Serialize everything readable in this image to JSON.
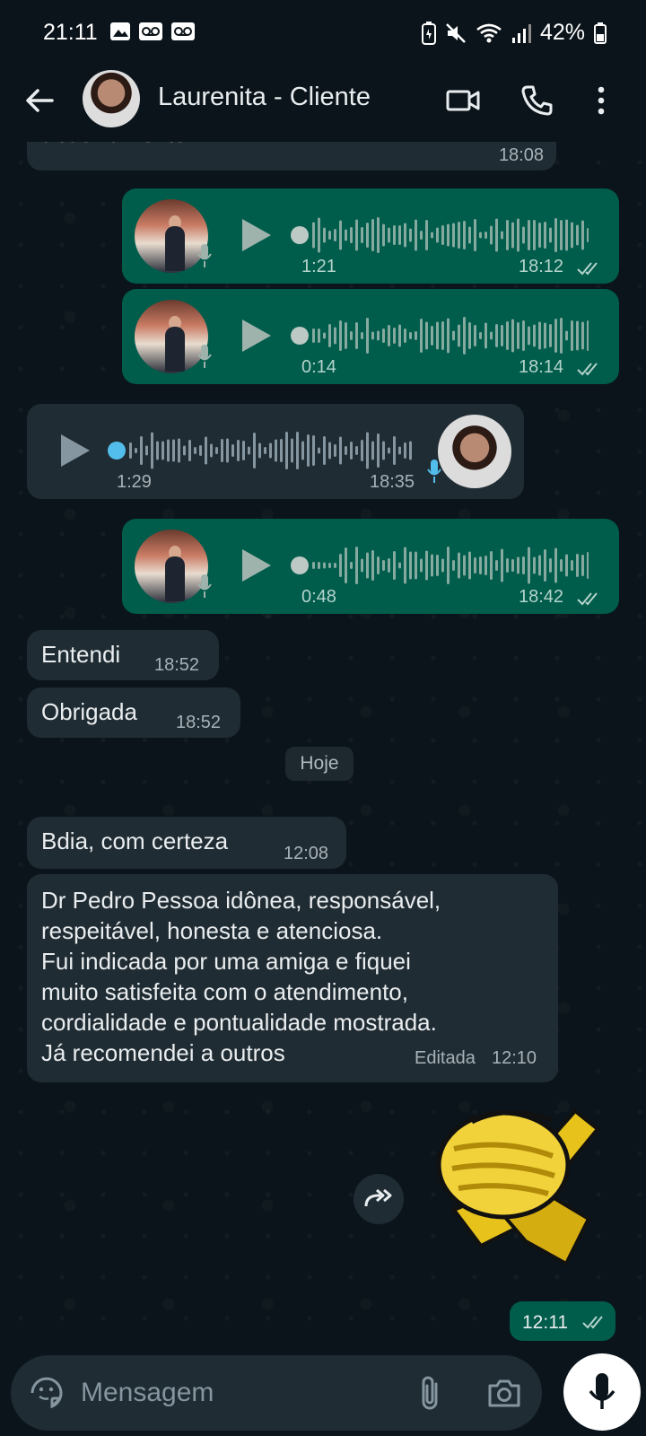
{
  "status_bar": {
    "time": "21:11",
    "battery": "42%"
  },
  "header": {
    "contact_name": "Laurenita - Cliente"
  },
  "messages": {
    "m1": {
      "text": "abusivamente?",
      "time": "18:08"
    },
    "v1": {
      "duration": "1:21",
      "time": "18:12"
    },
    "v2": {
      "duration": "0:14",
      "time": "18:14"
    },
    "v3": {
      "duration": "1:29",
      "time": "18:35"
    },
    "v4": {
      "duration": "0:48",
      "time": "18:42"
    },
    "m2": {
      "text": "Entendi",
      "time": "18:52"
    },
    "m3": {
      "text": "Obrigada",
      "time": "18:52"
    },
    "date_separator": "Hoje",
    "m4": {
      "text": "Bdia, com certeza",
      "time": "12:08"
    },
    "m5": {
      "lines": [
        "Dr Pedro Pessoa idônea, responsável,",
        "respeitável, honesta e atenciosa.",
        "Fui indicada por uma amiga e fiquei",
        "muito satisfeita com o atendimento,",
        "cordialidade e pontualidade mostrada.",
        "Já recomendei a outros"
      ],
      "edited_label": "Editada",
      "time": "12:10"
    },
    "sticker": {
      "time": "12:11"
    }
  },
  "composer": {
    "placeholder": "Mensagem"
  },
  "colors": {
    "background": "#0b141a",
    "incoming_bubble": "#202c33",
    "outgoing_bubble": "#005c4b",
    "text": "#e9edef",
    "unplayed_dot": "#53bdeb",
    "sticker_gold": "#e6c21a"
  }
}
